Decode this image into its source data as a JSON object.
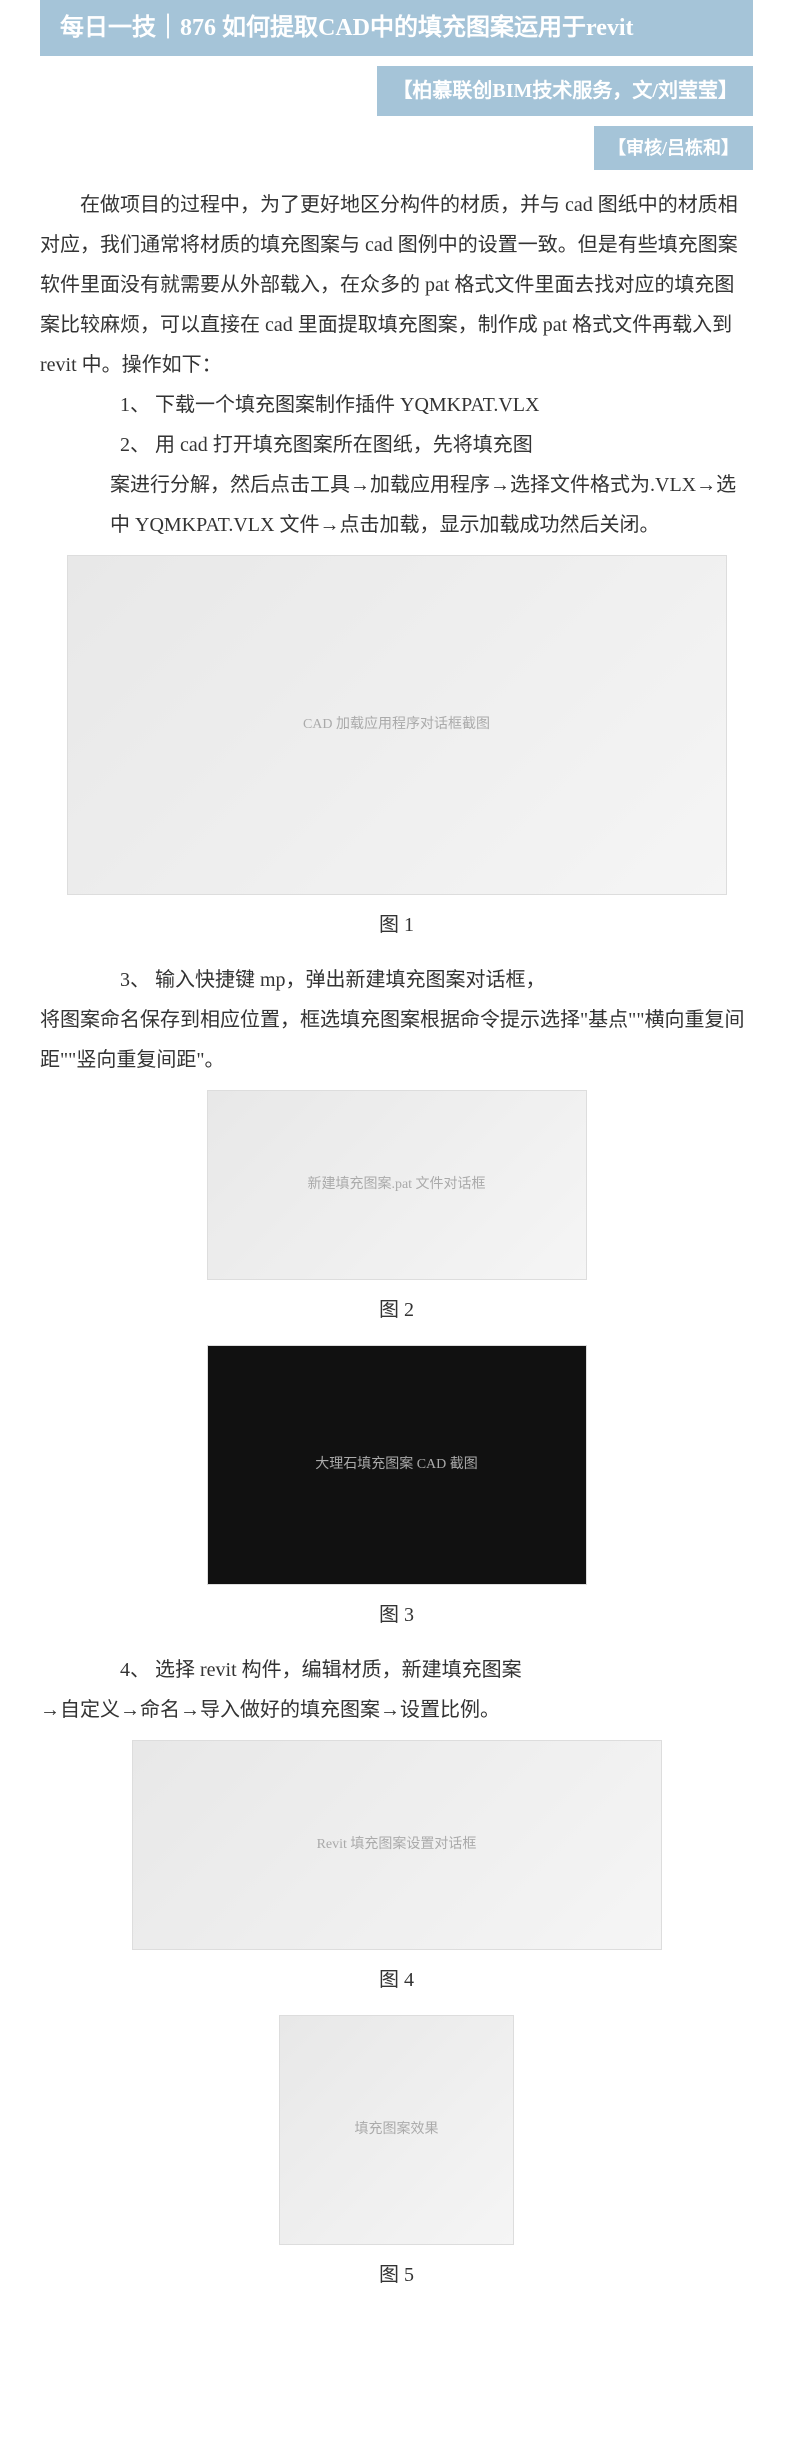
{
  "header": {
    "title": "每日一技｜876 如何提取CAD中的填充图案运用于revit",
    "subtitle": "【柏慕联创BIM技术服务，文/刘莹莹】",
    "reviewer": "【审核/吕栋和】"
  },
  "content": {
    "intro": "在做项目的过程中，为了更好地区分构件的材质，并与 cad 图纸中的材质相对应，我们通常将材质的填充图案与 cad 图例中的设置一致。但是有些填充图案软件里面没有就需要从外部载入，在众多的 pat 格式文件里面去找对应的填充图案比较麻烦，可以直接在 cad 里面提取填充图案，制作成 pat 格式文件再载入到 revit 中。操作如下：",
    "step1": "1、 下载一个填充图案制作插件 YQMKPAT.VLX",
    "step2a": "2、 用 cad 打开填充图案所在图纸，先将填充图",
    "step2b": "案进行分解，然后点击工具→加载应用程序→选择文件格式为.VLX→选中 YQMKPAT.VLX 文件→点击加载，显示加载成功然后关闭。",
    "step3a": "3、 输入快捷键 mp，弹出新建填充图案对话框，",
    "step3b": "将图案命名保存到相应位置，框选填充图案根据命令提示选择\"基点\"\"横向重复间距\"\"竖向重复间距\"。",
    "step4a": "4、 选择 revit 构件，编辑材质，新建填充图案",
    "step4b": "→自定义→命名→导入做好的填充图案→设置比例。"
  },
  "figures": {
    "fig1": "图 1",
    "fig2": "图 2",
    "fig3": "图 3",
    "fig4": "图 4",
    "fig5": "图 5"
  }
}
